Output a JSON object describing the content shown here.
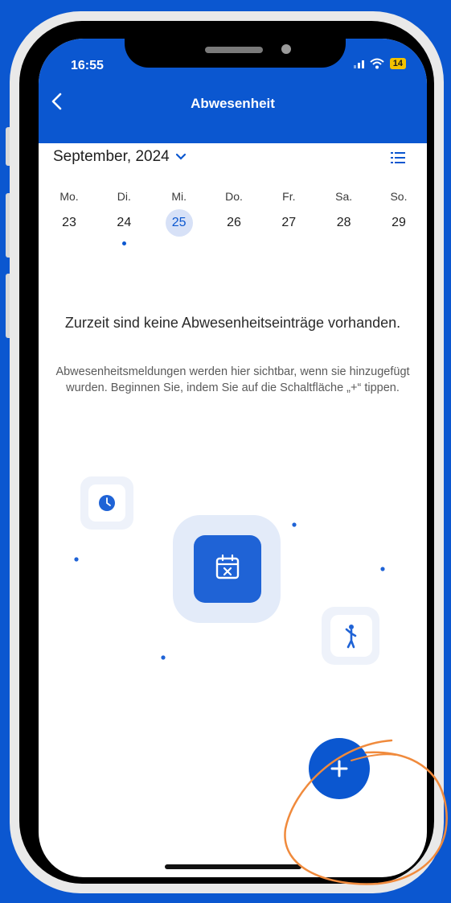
{
  "status": {
    "time": "16:55",
    "battery": "14"
  },
  "header": {
    "title": "Abwesenheit"
  },
  "calendar": {
    "month_label": "September, 2024",
    "days": [
      {
        "name": "Mo.",
        "num": "23"
      },
      {
        "name": "Di.",
        "num": "24"
      },
      {
        "name": "Mi.",
        "num": "25"
      },
      {
        "name": "Do.",
        "num": "26"
      },
      {
        "name": "Fr.",
        "num": "27"
      },
      {
        "name": "Sa.",
        "num": "28"
      },
      {
        "name": "So.",
        "num": "29"
      }
    ]
  },
  "empty_state": {
    "title": "Zurzeit sind keine Abwesenheitseinträge vorhanden.",
    "text": "Abwesenheitsmeldungen werden hier sichtbar, wenn sie hinzugefügt wurden. Beginnen Sie, indem Sie auf die Schaltfläche „+“ tippen."
  },
  "colors": {
    "brand_blue": "#0b57d0",
    "highlight_orange": "#f08a3c",
    "battery_yellow": "#f2c200"
  },
  "icons": [
    "back-arrow-icon",
    "chevron-down-icon",
    "list-view-icon",
    "clock-icon",
    "calendar-x-icon",
    "walking-person-icon",
    "plus-icon"
  ]
}
